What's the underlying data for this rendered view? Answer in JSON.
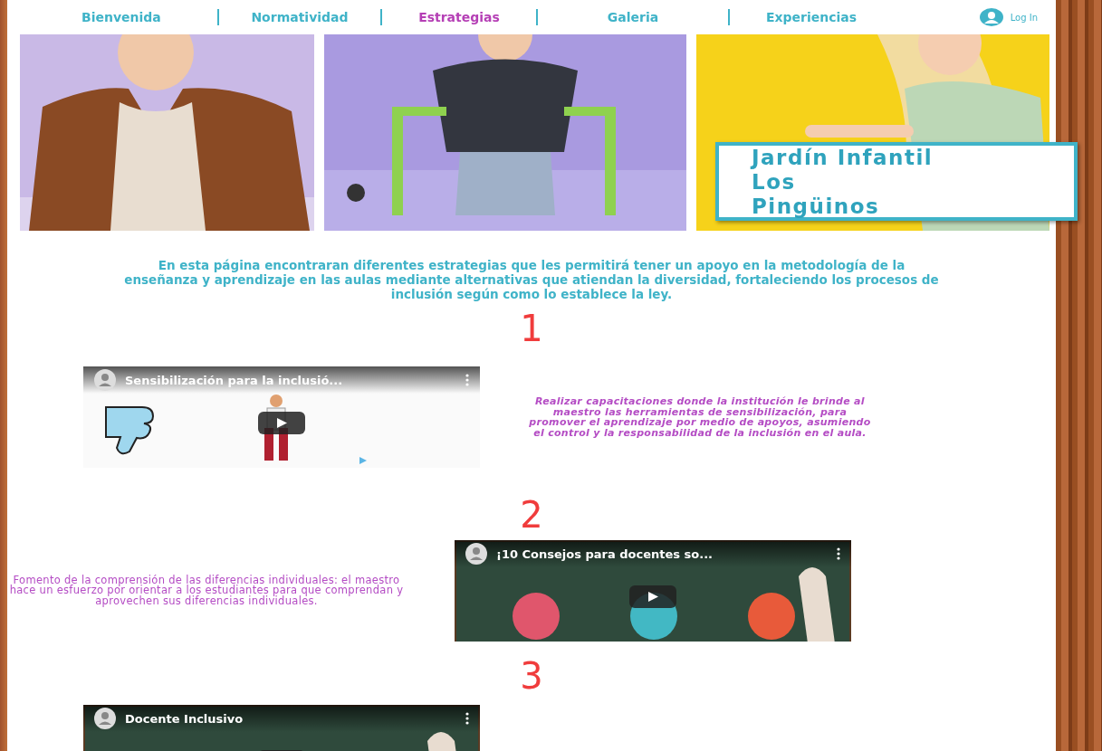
{
  "nav": {
    "items": [
      {
        "label": "Bienvenida",
        "selected": false
      },
      {
        "label": "Normatividad",
        "selected": false
      },
      {
        "label": "Estrategias",
        "selected": true
      },
      {
        "label": "Galeria",
        "selected": false
      },
      {
        "label": "Experiencias",
        "selected": false
      }
    ],
    "login": "Log In"
  },
  "hero": {
    "title_lines": [
      "Jardín Infantil",
      "Los",
      "Pingüinos"
    ]
  },
  "intro": "En esta página encontraran diferentes estrategias que les permitirá tener un apoyo en la metodología de la enseñanza y aprendizaje en las aulas mediante alternativas que atiendan la diversidad, fortaleciendo los procesos de inclusión según como lo establece la ley.",
  "strategies": [
    {
      "number": "1",
      "video": {
        "title": "Sensibilización para la inclusió..."
      },
      "text": "Realizar capacitaciones donde la institución le brinde al maestro las herramientas de sensibilización, para promover el aprendizaje por medio de apoyos, asumiendo el control y la responsabilidad de la inclusión en el aula."
    },
    {
      "number": "2",
      "video": {
        "title": "¡10 Consejos para docentes so..."
      },
      "text": "Fomento de la comprensión de las diferencias individuales: el maestro hace un esfuerzo por orientar a los estudiantes para que comprendan y aprovechen sus diferencias individuales."
    },
    {
      "number": "3",
      "video": {
        "title": "Docente Inclusivo"
      }
    }
  ]
}
